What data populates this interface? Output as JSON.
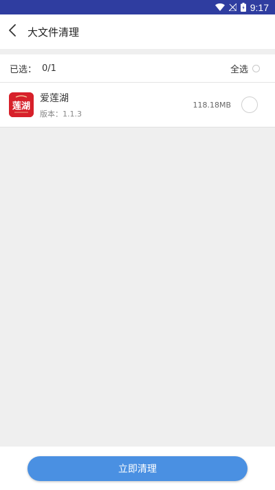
{
  "status_bar": {
    "time": "9:17",
    "icons": [
      "wifi-icon",
      "signal-icon",
      "battery-icon"
    ],
    "background": "#2f3da0"
  },
  "header": {
    "title": "大文件清理",
    "back_icon": "chevron-left-icon"
  },
  "selection": {
    "label": "已选：",
    "count": "0/1",
    "select_all_label": "全选",
    "select_all_checked": false
  },
  "files": [
    {
      "name": "爱莲湖",
      "icon_text": "莲湖",
      "version_label": "版本：",
      "version": "1.1.3",
      "size": "118.18MB",
      "checked": false
    }
  ],
  "footer": {
    "button_label": "立即清理",
    "button_color": "#4a90e2"
  }
}
